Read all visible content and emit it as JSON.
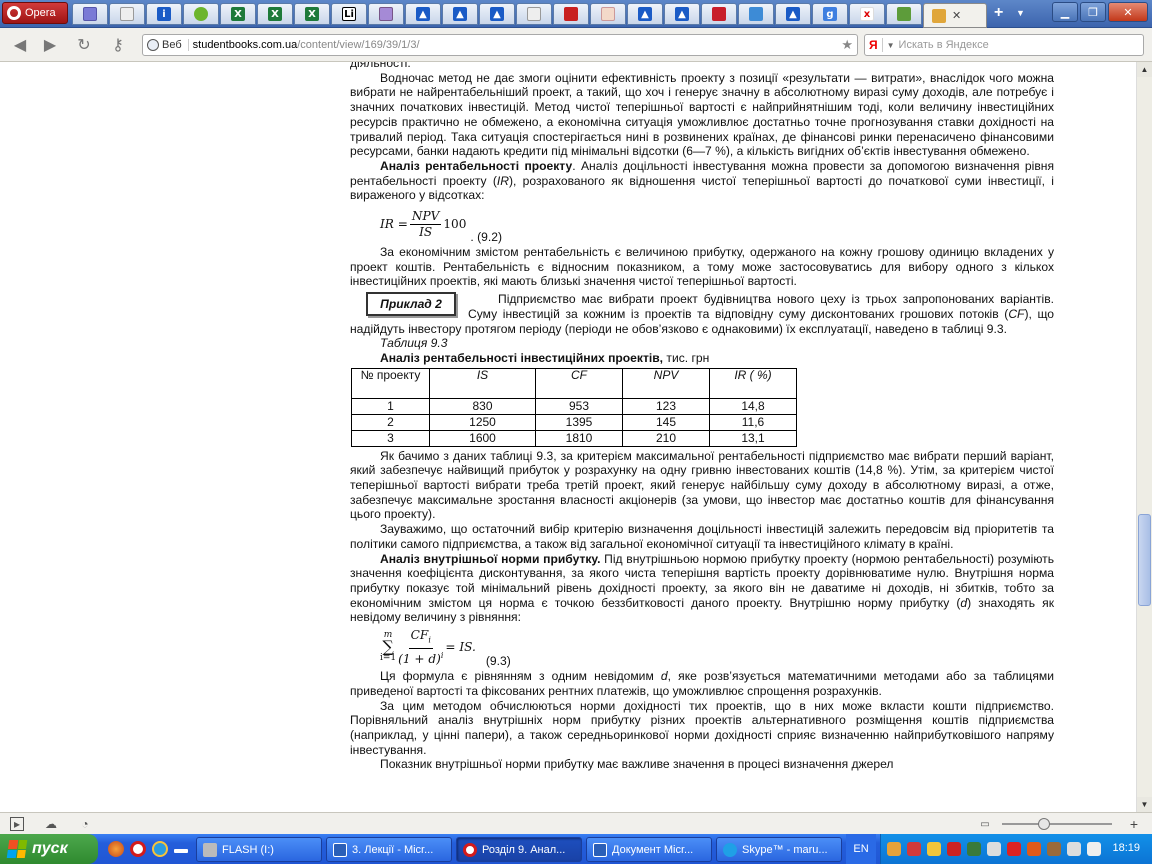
{
  "browser": {
    "menu_label": "Opera",
    "address": {
      "engine_label": "Веб",
      "domain": "studentbooks.com.ua",
      "path": "/content/view/169/39/1/3/"
    },
    "search_placeholder": "Искать в Яндексе",
    "search_logo": "Я"
  },
  "article": {
    "p0": "діяльності.",
    "p1": "Водночас метод не дає змоги оцінити ефективність проекту з позиції «результати — витрати», внаслідок чого можна вибрати не найрентабельніший проект, а такий, що хоч і генерує значну в абсолютному виразі суму доходів, але потребує і значних початкових інвестицій. Метод чистої теперішньої вартості є найприйнятнішим тоді, коли величину інвестиційних ресурсів практично не обмежено, а економічна ситуація уможливлює достатньо точне прогнозування ставки дохідності на тривалий період. Така ситуація спостерігається нині в розвинених країнах, де фінансові ринки перенасичено фінансовими ресурсами, банки надають кредити під мінімальні відсотки (6—7 %), а кількість вигідних об’єктів інвестування обмежено.",
    "p2_title": "Аналіз рентабельності проекту",
    "p2_a": ". Аналіз доцільності інвестування можна провести за допомогою визначення рівня рентабельності проекту (",
    "p2_ir": "IR",
    "p2_b": "), розрахованого як відношення чистої теперішньої вартості до початкової суми інвестиції, і вираженого у відсотках:",
    "f1": {
      "lhs": "IR =",
      "num": "NPV",
      "den": "IS",
      "mult": "100",
      "number": ". (9.2)"
    },
    "p3": "За економічним змістом рентабельність є величиною прибутку, одержаного на кожну грошову одиницю вкладених у проект коштів. Рентабельність є відносним показником, а тому може застосовуватись для вибору одного з кількох інвестиційних проектів, які мають близькі значення чистої теперішньої вартості.",
    "example_label": "Приклад 2",
    "p4_a": "Підприємство має вибрати проект будівництва нового цеху із трьох запропонованих варіантів. Суму інвестицій за кожним із проектів та відповідну суму дисконтованих грошових потоків (",
    "p4_cf": "CF",
    "p4_b": "), що надійдуть інвестору протягом періоду (періоди не обов’язково є однаковими) їх експлуатації, наведено в таблиці 9.3.",
    "table_label": "Таблиця 9.3",
    "table_title": "Аналіз рентабельності інвестиційних проектів,",
    "table_unit": " тис. грн",
    "table": {
      "headers": [
        "№ проекту",
        "IS",
        "CF",
        "NPV",
        "IR ( %)"
      ],
      "rows": [
        [
          "1",
          "830",
          "953",
          "123",
          "14,8"
        ],
        [
          "2",
          "1250",
          "1395",
          "145",
          "11,6"
        ],
        [
          "3",
          "1600",
          "1810",
          "210",
          "13,1"
        ]
      ]
    },
    "p5": "Як бачимо з даних таблиці 9.3, за критерієм максимальної рентабельності підприємство має вибрати перший варіант, який забезпечує найвищий прибуток у розрахунку на одну гривню інвестованих коштів (14,8 %). Утім, за критерієм чистої теперішньої вартості вибрати треба третій проект, який генерує найбільшу суму доходу в абсолютному виразі, а отже, забезпечує максимальне зростання власності акціонерів (за умови, що інвестор має достатньо коштів для фінансування цього проекту).",
    "p6": "Зауважимо, що остаточний вибір критерію визначення доцільності інвестицій залежить передовсім від пріоритетів та політики самого підприємства, а також від загальної економічної ситуації та інвестиційного клімату в країні.",
    "p7_title": "Аналіз внутрішньої норми прибутку.",
    "p7_a": " Під внутрішньою нормою прибутку проекту (нормою рентабельності) розуміють значення коефіцієнта дисконтування, за якого чиста теперішня вартість проекту дорівнюватиме нулю. Внутрішня норма прибутку показує той мінімальний рівень дохідності проекту, за якого він не даватиме ні доходів, ні збитків, тобто за економічним змістом ця норма є точкою беззбитковості даного проекту. Внутрішню норму прибутку (",
    "p7_d": "d",
    "p7_b": ") знаходять як невідому величину з рівняння:",
    "f2": {
      "sum_top": "m",
      "sum_bottom": "i=1",
      "num": "CF",
      "num_sub": "i",
      "den": "(1 + d)",
      "den_sup": "i",
      "rhs": "= IS.",
      "number": "(9.3)"
    },
    "p8_a": "Ця формула є рівнянням з одним невідомим ",
    "p8_d": "d",
    "p8_b": ", яке розв’язується математичними методами або за таблицями приведеної вартості та фіксованих рентних платежів, що уможливлює спрощення розрахунків.",
    "p9": "За цим методом обчислюються норми дохідності тих проектів, що в них може вкласти кошти підприємство. Порівняльний аналіз внутрішніх норм прибутку різних проектів альтернативного розміщення коштів підприємства (наприклад, у цінні папери), а також середньоринкової норми дохідності сприяє визначенню найприбутковішого напряму інвестування.",
    "p10": "Показник внутрішньої норми прибутку має важливе значення в процесі визначення джерел"
  },
  "taskbar": {
    "start_label": "пуск",
    "tasks": [
      "FLASH (I:)",
      "3. Лекції - Micr...",
      "Розділ 9. Анал...",
      "Документ Micr...",
      "Skype™ - maru..."
    ],
    "lang": "EN",
    "clock": "18:19"
  }
}
